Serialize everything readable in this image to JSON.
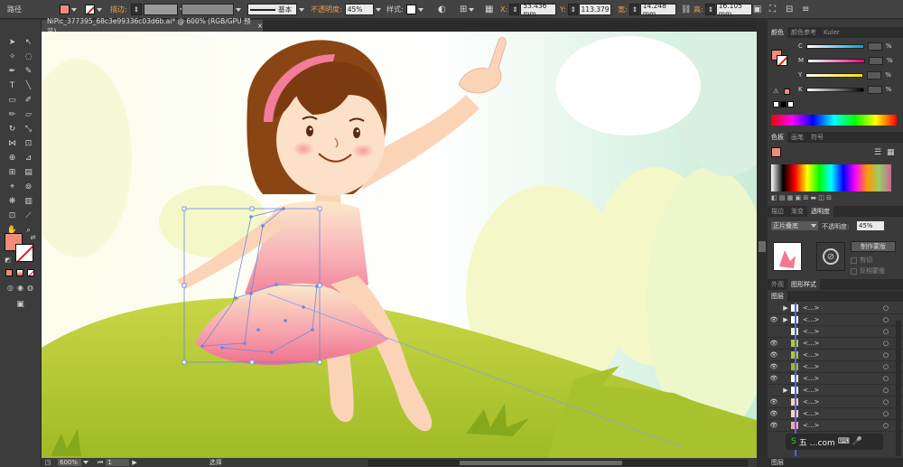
{
  "control_bar": {
    "path_label": "路径",
    "stroke_label": "描边:",
    "brush_label": "基本",
    "opacity_label": "不透明度:",
    "opacity_value": "45%",
    "style_label": "样式:",
    "x_label": "X:",
    "x_value": "53.436 mm",
    "y_label": "Y:",
    "y_value": "113.379",
    "w_label": "宽:",
    "w_value": "14.248 mm",
    "h_label": "高:",
    "h_value": "16.105 mm",
    "fill_color": "#f08c78"
  },
  "document": {
    "tab_title": "NiPic_377395_68c3e99336c03d6b.ai* @ 600% (RGB/GPU 预览)",
    "close_glyph": "×"
  },
  "status_bar": {
    "zoom": "600%",
    "page": "1",
    "mode": "选择"
  },
  "color_panel": {
    "tabs": [
      "颜色",
      "颜色参考",
      "Kuler"
    ],
    "channels": [
      "C",
      "M",
      "Y",
      "K"
    ],
    "pct_sign": "%"
  },
  "swatches_panel": {
    "tabs": [
      "色板",
      "画笔",
      "符号"
    ]
  },
  "transparency_panel": {
    "tabs": [
      "描边",
      "渐变",
      "透明度"
    ],
    "blend_mode": "正片叠底",
    "opacity_label": "不透明度:",
    "opacity_value": "45%",
    "make_mask_button": "制作蒙版",
    "clip_label": "剪切",
    "invert_label": "反相蒙版"
  },
  "appearance_panel": {
    "tabs": [
      "外观",
      "图形样式"
    ]
  },
  "layers_panel": {
    "tabs": [
      "图层"
    ],
    "rows": [
      "<...>",
      "<...>",
      "<...>",
      "<...>",
      "<...>",
      "<...>",
      "<...>",
      "<...>",
      "<...>",
      "<...>",
      "<...>"
    ],
    "footer_label": "图层",
    "watermark": "五  …com"
  }
}
